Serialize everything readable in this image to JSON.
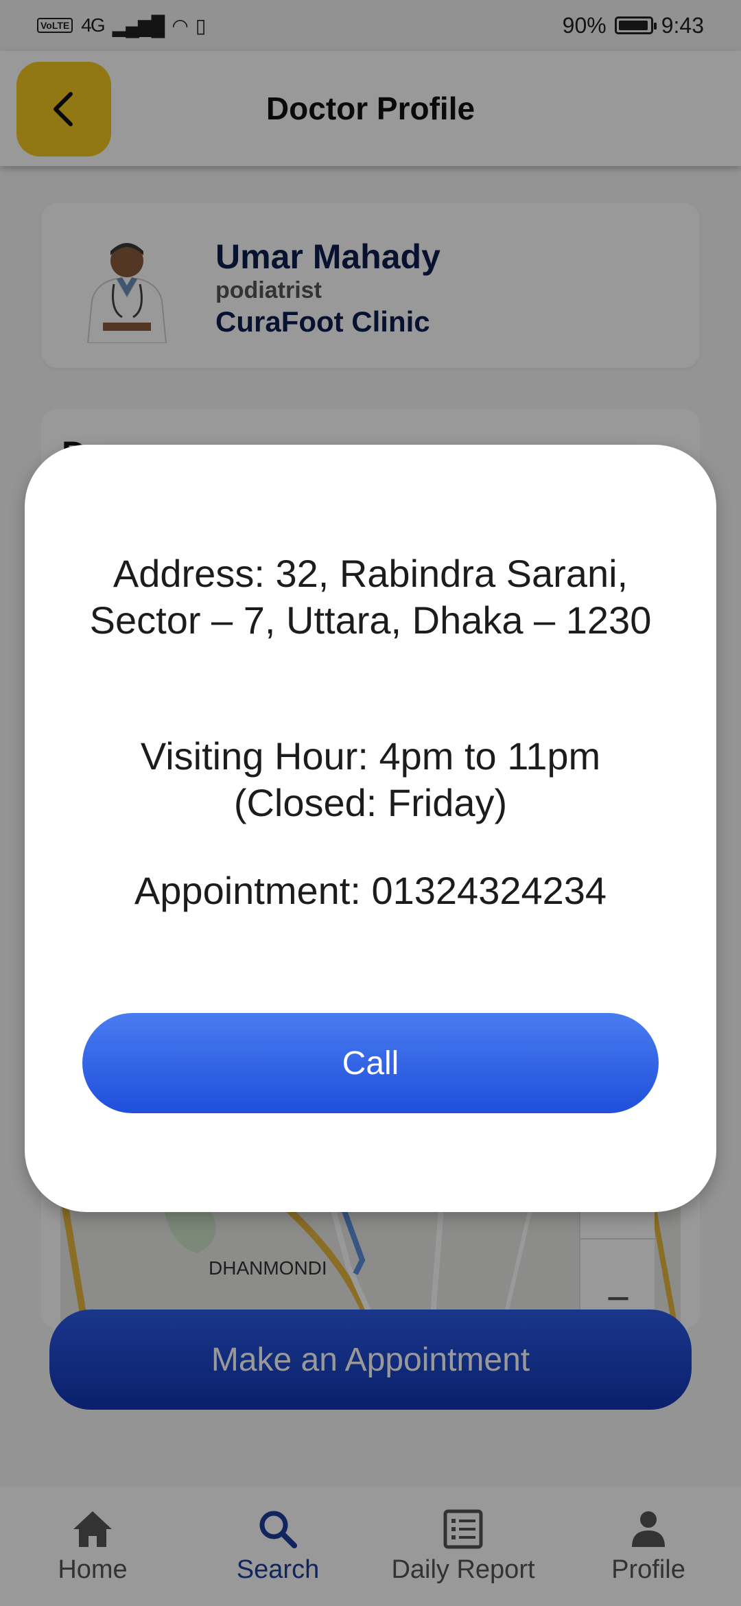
{
  "status_bar": {
    "volte": "VoLTE",
    "network": "4G",
    "battery": "90%",
    "time": "9:43"
  },
  "header": {
    "title": "Doctor Profile"
  },
  "doctor": {
    "name": "Umar Mahady",
    "specialty": "podiatrist",
    "clinic": "CuraFoot Clinic"
  },
  "details_card": {
    "heading_initial": "D"
  },
  "map": {
    "area_label": "DHANMONDI",
    "zoom_in": "+",
    "zoom_out": "−"
  },
  "appointment_button": "Make an Appointment",
  "modal": {
    "address": "Address: 32, Rabindra Sarani, Sector – 7, Uttara, Dhaka – 1230",
    "visiting_hour": "Visiting Hour: 4pm to 11pm (Closed: Friday)",
    "appointment": "Appointment: 01324324234",
    "call_label": "Call"
  },
  "bottom_nav": {
    "items": [
      {
        "label": "Home",
        "icon": "home-icon",
        "active": false
      },
      {
        "label": "Search",
        "icon": "search-icon",
        "active": true
      },
      {
        "label": "Daily Report",
        "icon": "report-icon",
        "active": false
      },
      {
        "label": "Profile",
        "icon": "profile-icon",
        "active": false
      }
    ]
  },
  "colors": {
    "accent_yellow": "#f3c623",
    "primary_blue": "#1f4fdc",
    "nav_active": "#1d3d9c",
    "name_navy": "#0b1f4f"
  }
}
